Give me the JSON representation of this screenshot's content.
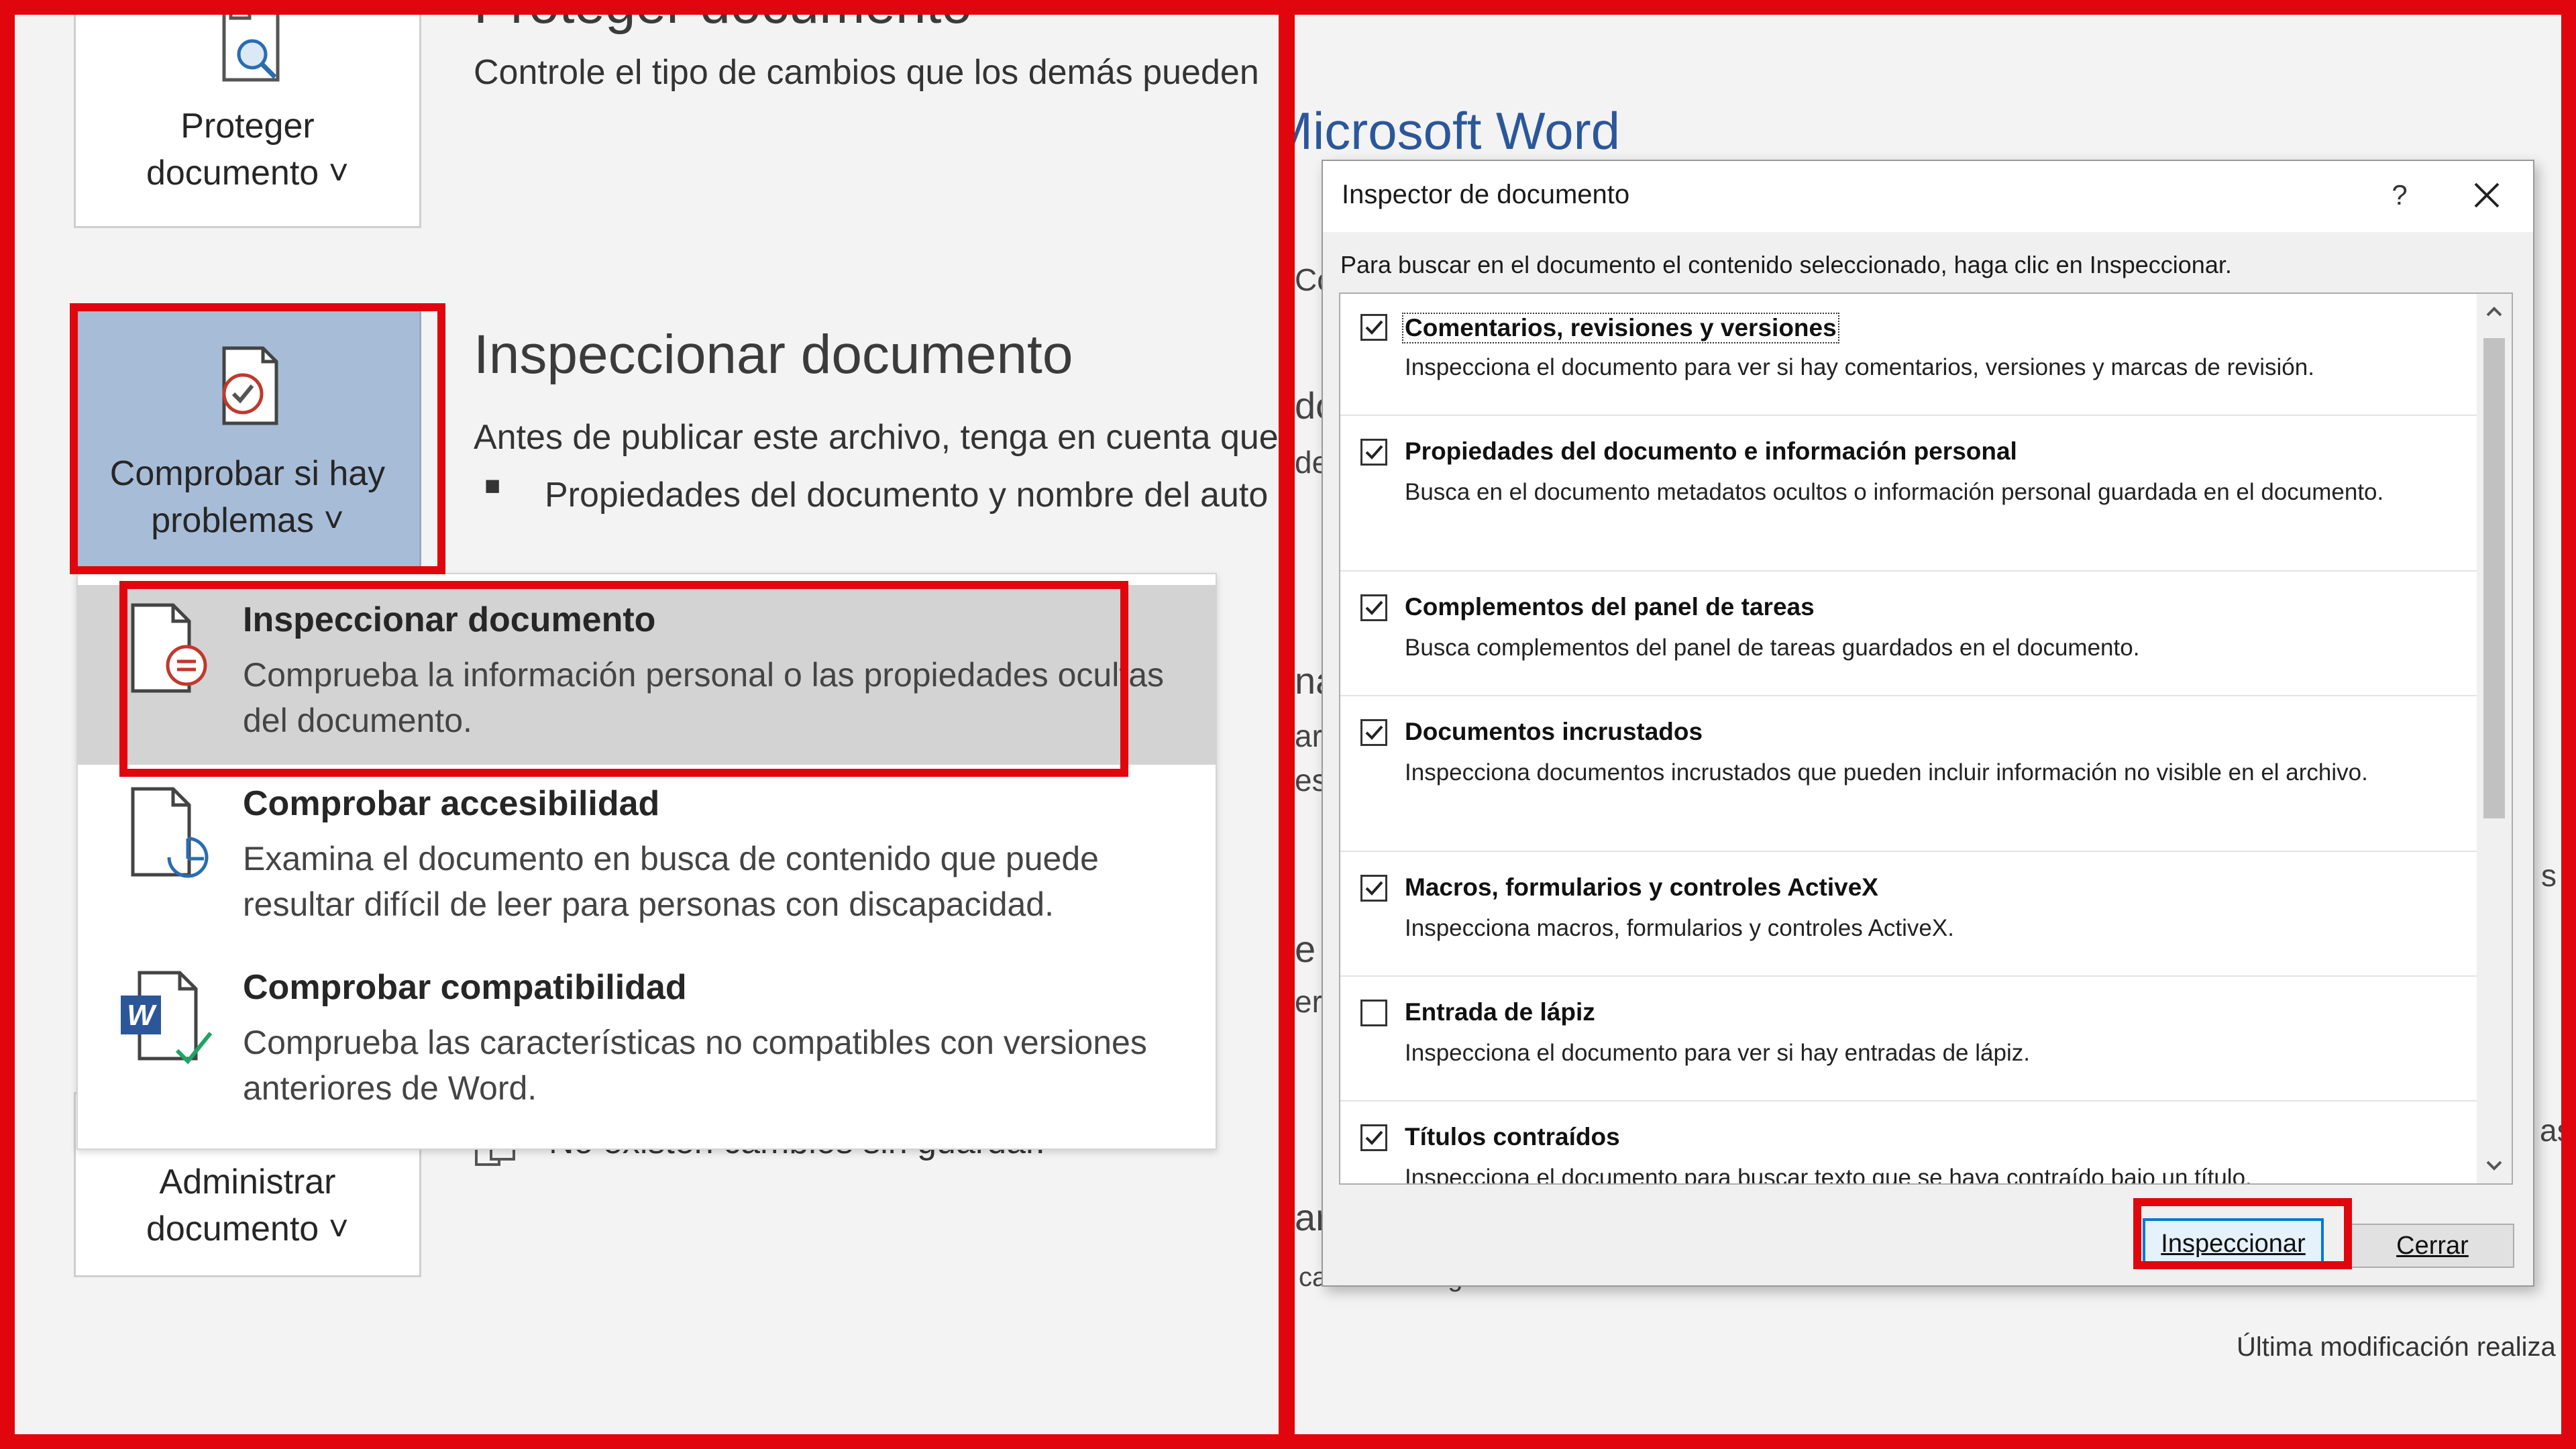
{
  "left": {
    "protect_section": {
      "title_partial": "Proteger documento",
      "description": "Controle el tipo de cambios que los demás pueden",
      "button_line1": "Proteger",
      "button_line2": "documento ˅"
    },
    "inspect_section": {
      "title": "Inspeccionar documento",
      "description": "Antes de publicar este archivo, tenga en cuenta que",
      "bullet": "Propiedades del documento y nombre del auto",
      "button_line1": "Comprobar si hay",
      "button_line2": "problemas ˅"
    },
    "manage_section": {
      "status": "No existen cambios sin guardar.",
      "button_line1": "Administrar",
      "button_line2": "documento ˅"
    },
    "menu": [
      {
        "title": "Inspeccionar documento",
        "description": "Comprueba la información personal o las propiedades ocultas del documento.",
        "icon": "inspect-document-icon"
      },
      {
        "title": "Comprobar accesibilidad",
        "description": "Examina el documento en busca de contenido que puede resultar difícil de leer para personas con discapacidad.",
        "icon": "accessibility-icon"
      },
      {
        "title": "Comprobar compatibilidad",
        "description": "Comprueba las características no compatibles con versiones anteriores de Word.",
        "icon": "word-compatibility-icon"
      }
    ]
  },
  "right": {
    "window_title": "Microsoft Word",
    "peek_fragments": [
      "Co",
      "do",
      "de",
      "na",
      "ar",
      "es",
      "e",
      "ers",
      "ar",
      "cambios sin guardar.",
      "s",
      "as"
    ],
    "last_modified": "Última modificación realiza",
    "dialog": {
      "title": "Inspector de documento",
      "help": "?",
      "instructions": "Para buscar en el documento el contenido seleccionado, haga clic en Inspeccionar.",
      "items": [
        {
          "title": "Comentarios, revisiones y versiones",
          "description": "Inspecciona el documento para ver si hay comentarios, versiones y marcas de revisión.",
          "checked": true
        },
        {
          "title": "Propiedades del documento e información personal",
          "description": "Busca en el documento metadatos ocultos o información personal guardada en el documento.",
          "checked": true
        },
        {
          "title": "Complementos del panel de tareas",
          "description": "Busca complementos del panel de tareas guardados en el documento.",
          "checked": true
        },
        {
          "title": "Documentos incrustados",
          "description": "Inspecciona documentos incrustados que pueden incluir información no visible en el archivo.",
          "checked": true
        },
        {
          "title": "Macros, formularios y controles ActiveX",
          "description": "Inspecciona macros, formularios y controles ActiveX.",
          "checked": true
        },
        {
          "title": "Entrada de lápiz",
          "description": "Inspecciona el documento para ver si hay entradas de lápiz.",
          "checked": false
        },
        {
          "title": "Títulos contraídos",
          "description": "Inspecciona el documento para buscar texto que se haya contraído bajo un título.",
          "checked": true
        }
      ],
      "inspect_button": "Inspeccionar",
      "close_button": "Cerrar"
    }
  },
  "colors": {
    "highlight_red": "#e1060d",
    "ribbon_selected": "#a7bcd7",
    "word_blue": "#2b579a",
    "focus_blue": "#0078d7"
  }
}
